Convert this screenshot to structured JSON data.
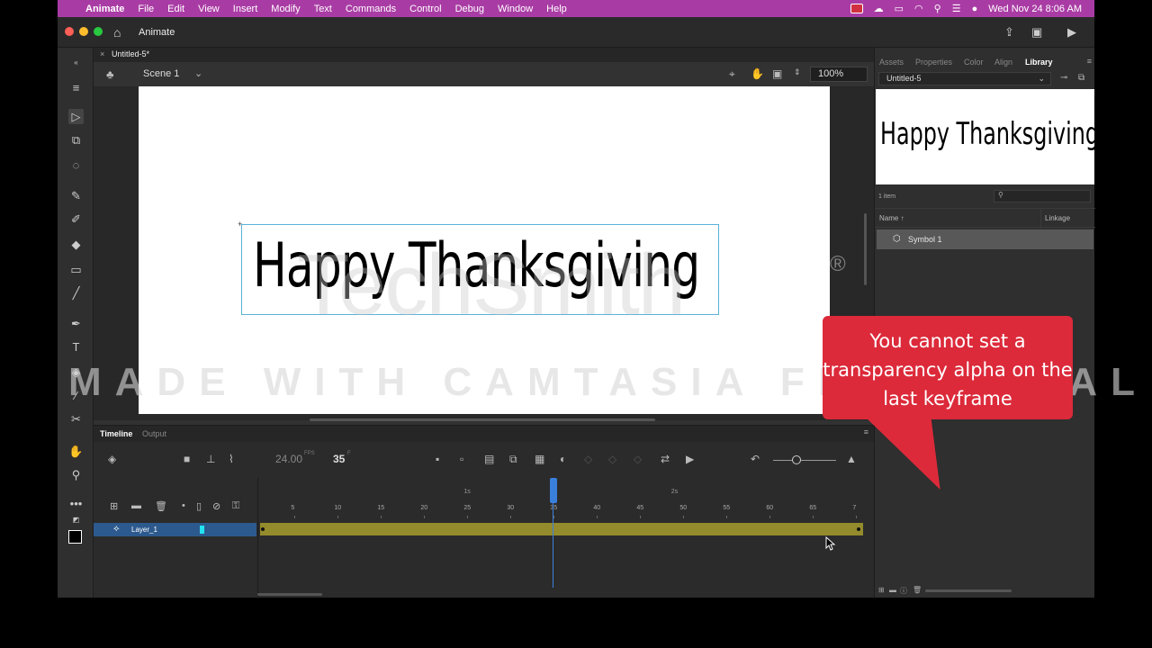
{
  "menubar": {
    "app_name": "Animate",
    "items": [
      "File",
      "Edit",
      "View",
      "Insert",
      "Modify",
      "Text",
      "Commands",
      "Control",
      "Debug",
      "Window",
      "Help"
    ],
    "datetime": "Wed Nov 24  8:06 AM"
  },
  "titlebar": {
    "app_tab": "Animate"
  },
  "document": {
    "tab": "Untitled-5*"
  },
  "scenebar": {
    "scene": "Scene 1",
    "zoom": "100%"
  },
  "stage": {
    "text": "Happy Thanksgiving"
  },
  "timeline": {
    "tabs": [
      "Timeline",
      "Output"
    ],
    "fps": "24.00",
    "fps_unit": "FPS",
    "current_frame": "35",
    "frame_unit": "F",
    "second_markers": [
      "1s",
      "2s"
    ],
    "frame_numbers": [
      "5",
      "10",
      "15",
      "20",
      "25",
      "30",
      "35",
      "40",
      "45",
      "50",
      "55",
      "60",
      "65",
      "7"
    ],
    "layer_name": "Layer_1",
    "playhead_frame": 35
  },
  "library": {
    "tabs": [
      "Assets",
      "Properties",
      "Color",
      "Align",
      "Library"
    ],
    "active_tab": "Library",
    "document": "Untitled-5",
    "preview_text": "Happy Thanksgiving",
    "item_count": "1 item",
    "columns": {
      "name": "Name",
      "linkage": "Linkage"
    },
    "items": [
      "Symbol 1"
    ]
  },
  "overlay": {
    "watermark_logo": "TechSmith",
    "watermark_reg": "®",
    "watermark_text": "MADE WITH CAMTASIA FREE TRIAL",
    "callout_text": "You cannot set a transparency alpha on the last keyframe",
    "callout_color": "#dc2a3a"
  },
  "colors": {
    "menubar": "#a93ca4",
    "layer_highlight": "#2d5a8e",
    "tween_span": "#948b2c",
    "playhead": "#3a7fdc",
    "bounding_box": "#5ab1d8"
  }
}
